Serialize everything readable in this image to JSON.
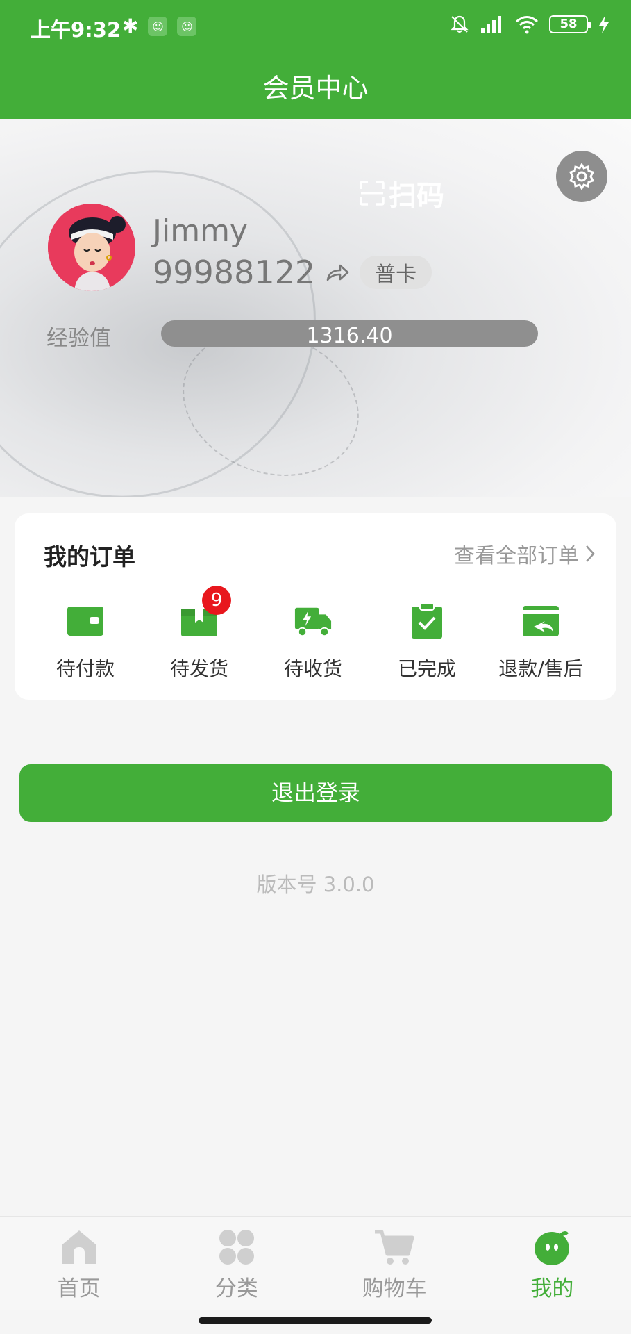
{
  "status_bar": {
    "time": "上午9:32",
    "battery": "58"
  },
  "header": {
    "title": "会员中心"
  },
  "profile": {
    "scan_label": "扫码",
    "username": "Jimmy",
    "member_number": "99988122",
    "card_level": "普卡",
    "exp_label": "经验值",
    "exp_value": "1316.40",
    "exp_progress": 1.0
  },
  "orders": {
    "title": "我的订单",
    "view_all": "查看全部订单",
    "items": [
      {
        "label": "待付款",
        "icon": "wallet-icon"
      },
      {
        "label": "待发货",
        "icon": "package-icon",
        "badge": "9"
      },
      {
        "label": "待收货",
        "icon": "delivery-truck-icon"
      },
      {
        "label": "已完成",
        "icon": "clipboard-check-icon"
      },
      {
        "label": "退款/售后",
        "icon": "refund-icon"
      }
    ]
  },
  "logout_label": "退出登录",
  "version": "版本号 3.0.0",
  "tabbar": {
    "items": [
      {
        "label": "首页",
        "icon": "home-icon"
      },
      {
        "label": "分类",
        "icon": "category-icon"
      },
      {
        "label": "购物车",
        "icon": "cart-icon"
      },
      {
        "label": "我的",
        "icon": "profile-icon",
        "active": true
      }
    ]
  },
  "colors": {
    "brand_green": "#43ae39",
    "badge_red": "#e8171d",
    "inactive_gray": "#c8c8c8"
  }
}
